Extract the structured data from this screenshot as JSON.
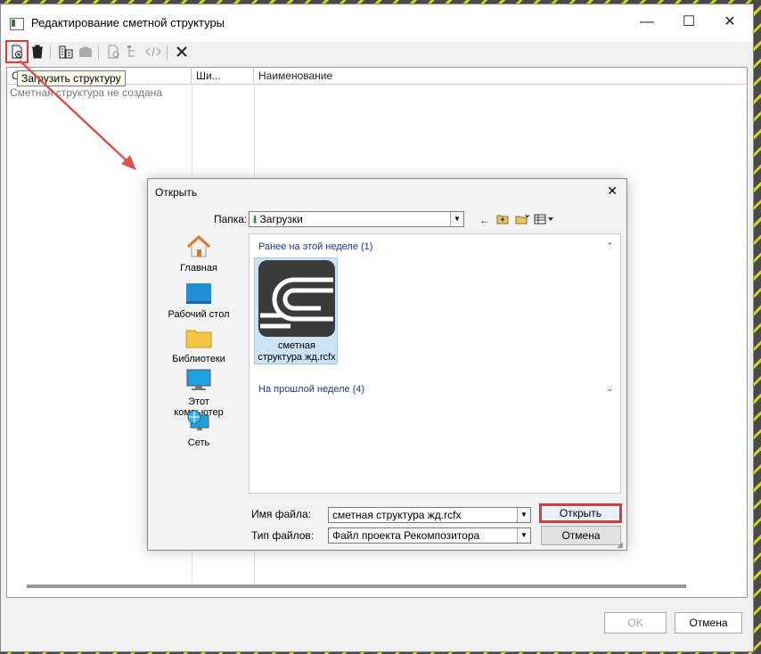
{
  "window": {
    "title": "Редактирование сметной структуры",
    "controls": {
      "minimize": "—",
      "maximize": "☐",
      "close": "✕"
    }
  },
  "toolbar": {
    "tooltip": "Загрузить структуру",
    "icons": [
      "load-structure-icon",
      "delete-icon",
      "structure-icon",
      "folder-icon",
      "check-icon",
      "tree-icon",
      "code-icon",
      "close-x-icon"
    ]
  },
  "grid": {
    "columns": [
      "С",
      "Ши...",
      "Наименование"
    ],
    "empty_text": "Сметная структура не создана"
  },
  "footer": {
    "ok_label": "OK",
    "cancel_label": "Отмена"
  },
  "open_dialog": {
    "title": "Открыть",
    "folder_label": "Папка:",
    "folder_value": "Загрузки",
    "places": [
      {
        "label": "Главная",
        "icon": "home-icon"
      },
      {
        "label": "Рабочий стол",
        "icon": "desktop-icon"
      },
      {
        "label": "Библиотеки",
        "icon": "library-folder-icon"
      },
      {
        "label": "Этот компьютер",
        "icon": "computer-icon"
      },
      {
        "label": "Сеть",
        "icon": "network-icon"
      }
    ],
    "groups": [
      {
        "label": "Ранее на этой неделе (1)",
        "chevron": "⌃"
      },
      {
        "label": "На прошлой неделе (4)",
        "chevron": "⌄"
      }
    ],
    "file": {
      "name_line1": "сметная",
      "name_line2": "структура жд.rcfx"
    },
    "filename_label": "Имя файла:",
    "filename_value": "сметная структура жд.rcfx",
    "filetype_label": "Тип файлов:",
    "filetype_value": "Файл проекта Рекомпозитора",
    "open_label": "Открыть",
    "cancel_label": "Отмена"
  },
  "colors": {
    "highlight": "#d73b3b",
    "selection": "#cce4f7",
    "group_text": "#1e3a8a"
  }
}
